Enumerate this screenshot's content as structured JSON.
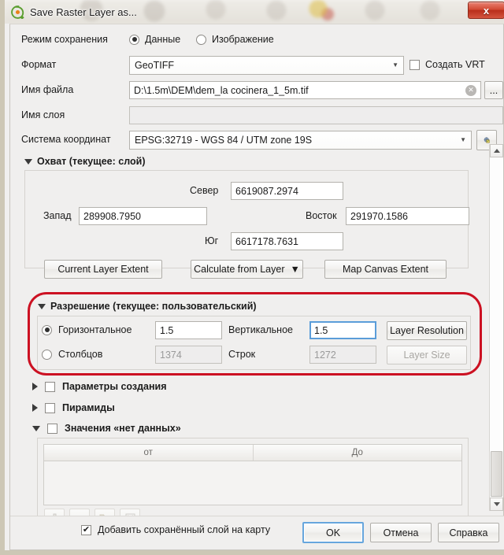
{
  "window": {
    "title": "Save Raster Layer as...",
    "logo_icon": "qgis-logo-icon",
    "close_label": "x"
  },
  "form": {
    "save_mode": {
      "label": "Режим сохранения",
      "options": [
        "Данные",
        "Изображение"
      ],
      "selected": "Данные"
    },
    "format": {
      "label": "Формат",
      "value": "GeoTIFF",
      "caret": "▼"
    },
    "create_vrt": {
      "label": "Создать VRT",
      "checked": false
    },
    "file_name": {
      "label": "Имя файла",
      "value": "D:\\1.5m\\DEM\\dem_la cocinera_1_5m.tif",
      "clear_icon": "clear-circle-icon",
      "browse_label": "..."
    },
    "layer_name": {
      "label": "Имя слоя",
      "value": "",
      "placeholder": ""
    },
    "crs": {
      "label": "Система координат",
      "value": "EPSG:32719 - WGS 84 / UTM zone 19S",
      "caret": "▼",
      "select_icon": "globe-crs-icon"
    }
  },
  "extent": {
    "title": "Охват (текущее: слой)",
    "expanded": true,
    "north": {
      "label": "Север",
      "value": "6619087.2974"
    },
    "west": {
      "label": "Запад",
      "value": "289908.7950"
    },
    "east": {
      "label": "Восток",
      "value": "291970.1586"
    },
    "south": {
      "label": "Юг",
      "value": "6617178.7631"
    },
    "buttons": {
      "current_layer_extent": "Current Layer Extent",
      "calculate_from_layer": "Calculate from Layer",
      "calculate_caret": "▼",
      "map_canvas_extent": "Map Canvas Extent"
    }
  },
  "resolution": {
    "title": "Разрешение (текущее: пользовательский)",
    "expanded": true,
    "highlighted": true,
    "highlight_color": "#cc1122",
    "mode_selected": "horizontal",
    "horizontal": {
      "label": "Горизонтальное",
      "value": "1.5",
      "selected": true
    },
    "vertical": {
      "label": "Вертикальное",
      "value": "1.5",
      "focused": true
    },
    "layer_resolution_button": "Layer Resolution",
    "columns": {
      "label": "Столбцов",
      "value": "1374",
      "selected": false,
      "disabled": true
    },
    "rows": {
      "label": "Строк",
      "value": "1272",
      "disabled": true
    },
    "layer_size_button": "Layer Size"
  },
  "sections": [
    {
      "title": "Параметры создания",
      "expanded": false,
      "checked": false
    },
    {
      "title": "Пирамиды",
      "expanded": false,
      "checked": false
    }
  ],
  "nodata": {
    "title": "Значения «нет данных»",
    "expanded": true,
    "checked": false,
    "columns": [
      "от",
      "До"
    ],
    "rows": [],
    "toolbar": [
      {
        "name": "add-row-button",
        "glyph": "+"
      },
      {
        "name": "remove-row-button",
        "glyph": "–"
      },
      {
        "name": "load-file-button",
        "glyph": "folder"
      },
      {
        "name": "clear-all-button",
        "glyph": "x"
      }
    ]
  },
  "footer": {
    "add_layer_checkbox": {
      "label": "Добавить сохранённый слой на карту",
      "checked": true,
      "mark": "✔"
    },
    "ok": "OK",
    "cancel": "Отмена",
    "help": "Справка"
  }
}
